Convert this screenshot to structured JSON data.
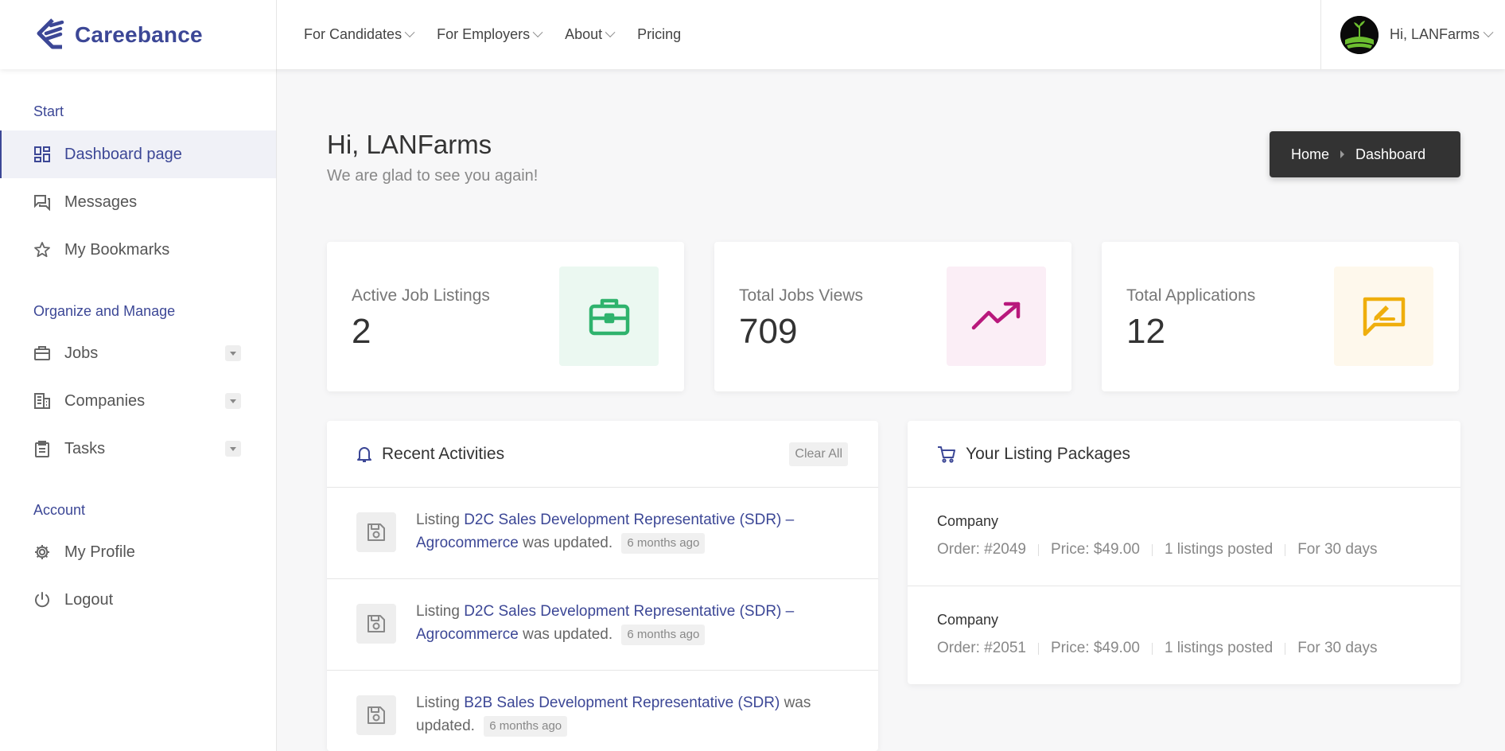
{
  "header": {
    "brand": "Careebance",
    "nav": [
      "For Candidates",
      "For Employers",
      "About",
      "Pricing"
    ],
    "user_greeting": "Hi, LANFarms"
  },
  "sidebar": {
    "sections": [
      {
        "title": "Start",
        "items": [
          {
            "label": "Dashboard page",
            "icon": "dashboard-icon",
            "active": true
          },
          {
            "label": "Messages",
            "icon": "messages-icon"
          },
          {
            "label": "My Bookmarks",
            "icon": "star-icon"
          }
        ]
      },
      {
        "title": "Organize and Manage",
        "items": [
          {
            "label": "Jobs",
            "icon": "briefcase-icon",
            "expandable": true
          },
          {
            "label": "Companies",
            "icon": "building-icon",
            "expandable": true
          },
          {
            "label": "Tasks",
            "icon": "clipboard-icon",
            "expandable": true
          }
        ]
      },
      {
        "title": "Account",
        "items": [
          {
            "label": "My Profile",
            "icon": "gear-icon"
          },
          {
            "label": "Logout",
            "icon": "power-icon"
          }
        ]
      }
    ]
  },
  "greeting": {
    "title": "Hi, LANFarms",
    "subtitle": "We are glad to see you again!"
  },
  "breadcrumb": {
    "home": "Home",
    "current": "Dashboard"
  },
  "stats": [
    {
      "label": "Active Job Listings",
      "value": "2",
      "icon": "briefcase-icon",
      "color": "#2fb36d",
      "bg": "#ebf8f1"
    },
    {
      "label": "Total Jobs Views",
      "value": "709",
      "icon": "trending-up-icon",
      "color": "#b8187c",
      "bg": "#fbeef6"
    },
    {
      "label": "Total Applications",
      "value": "12",
      "icon": "edit-message-icon",
      "color": "#efae0c",
      "bg": "#fef8ec"
    }
  ],
  "activities": {
    "title": "Recent Activities",
    "clear_label": "Clear All",
    "items": [
      {
        "prefix": "Listing",
        "link": "D2C Sales Development Representative (SDR) – Agrocommerce",
        "suffix": "was updated.",
        "time": "6 months ago"
      },
      {
        "prefix": "Listing",
        "link": "D2C Sales Development Representative (SDR) – Agrocommerce",
        "suffix": "was updated.",
        "time": "6 months ago"
      },
      {
        "prefix": "Listing",
        "link": "B2B Sales Development Representative (SDR)",
        "suffix": "was updated.",
        "time": "6 months ago"
      }
    ]
  },
  "packages": {
    "title": "Your Listing Packages",
    "items": [
      {
        "name": "Company",
        "order": "Order: #2049",
        "price": "Price: $49.00",
        "posted": "1 listings posted",
        "duration": "For 30 days"
      },
      {
        "name": "Company",
        "order": "Order: #2051",
        "price": "Price: $49.00",
        "posted": "1 listings posted",
        "duration": "For 30 days"
      }
    ]
  },
  "colors": {
    "brand": "#3c4796",
    "breadcrumb_bg": "#333333"
  }
}
